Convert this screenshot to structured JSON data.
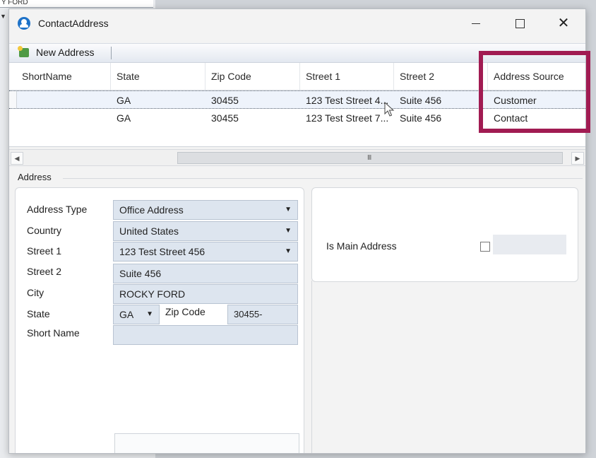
{
  "background": {
    "top_fragment": "Y FORD"
  },
  "window": {
    "title": "ContactAddress",
    "controls": {
      "minimize": "—",
      "maximize": "☐",
      "close": "✕"
    }
  },
  "toolbar": {
    "new_address_label": "New Address"
  },
  "grid": {
    "columns": [
      "ShortName",
      "State",
      "Zip Code",
      "Street 1",
      "Street 2",
      "Address Source"
    ],
    "rows": [
      {
        "shortname": "",
        "state": "GA",
        "zip": "30455",
        "street1": "123 Test Street 4...",
        "street2": "Suite 456",
        "source": "Customer"
      },
      {
        "shortname": "",
        "state": "GA",
        "zip": "30455",
        "street1": "123 Test Street 7...",
        "street2": "Suite 456",
        "source": "Contact"
      }
    ],
    "scroll_grip": "III"
  },
  "address_group": {
    "label": "Address",
    "fields": {
      "address_type_label": "Address Type",
      "address_type_value": "Office Address",
      "country_label": "Country",
      "country_value": "United States",
      "street1_label": "Street 1",
      "street1_value": "123 Test Street 456",
      "street2_label": "Street 2",
      "street2_value": "Suite 456",
      "city_label": "City",
      "city_value": "ROCKY FORD",
      "state_label": "State",
      "state_value": "GA",
      "zip_label": "Zip Code",
      "zip_value": "30455-",
      "short_name_label": "Short Name",
      "short_name_value": ""
    },
    "is_main_address_label": "Is Main Address"
  },
  "colors": {
    "highlight": "#a11b52",
    "field_bg": "#dde5ef",
    "accent": "#1e72c8"
  }
}
